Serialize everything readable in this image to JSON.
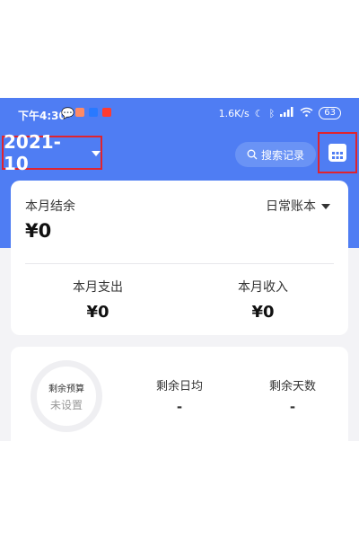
{
  "status_bar": {
    "time": "下午4:30",
    "net_speed": "1.6K/s",
    "battery": "63"
  },
  "header": {
    "month": "2021-10",
    "search_label": "搜索记录"
  },
  "summary_card": {
    "balance_label": "本月结余",
    "balance_value": "¥0",
    "book_label": "日常账本",
    "expense_label": "本月支出",
    "expense_value": "¥0",
    "income_label": "本月收入",
    "income_value": "¥0"
  },
  "budget_card": {
    "ring_title": "剩余预算",
    "ring_status": "未设置",
    "daily_label": "剩余日均",
    "daily_value": "-",
    "days_label": "剩余天数",
    "days_value": "-"
  },
  "colors": {
    "primary": "#4f7df3",
    "highlight_border": "#e0232e",
    "background": "#f3f3f6"
  },
  "icons": [
    "chat-icon",
    "moon-icon",
    "bluetooth-icon",
    "signal-icon",
    "wifi-icon",
    "search-icon",
    "calendar-icon",
    "chevron-down-icon"
  ]
}
